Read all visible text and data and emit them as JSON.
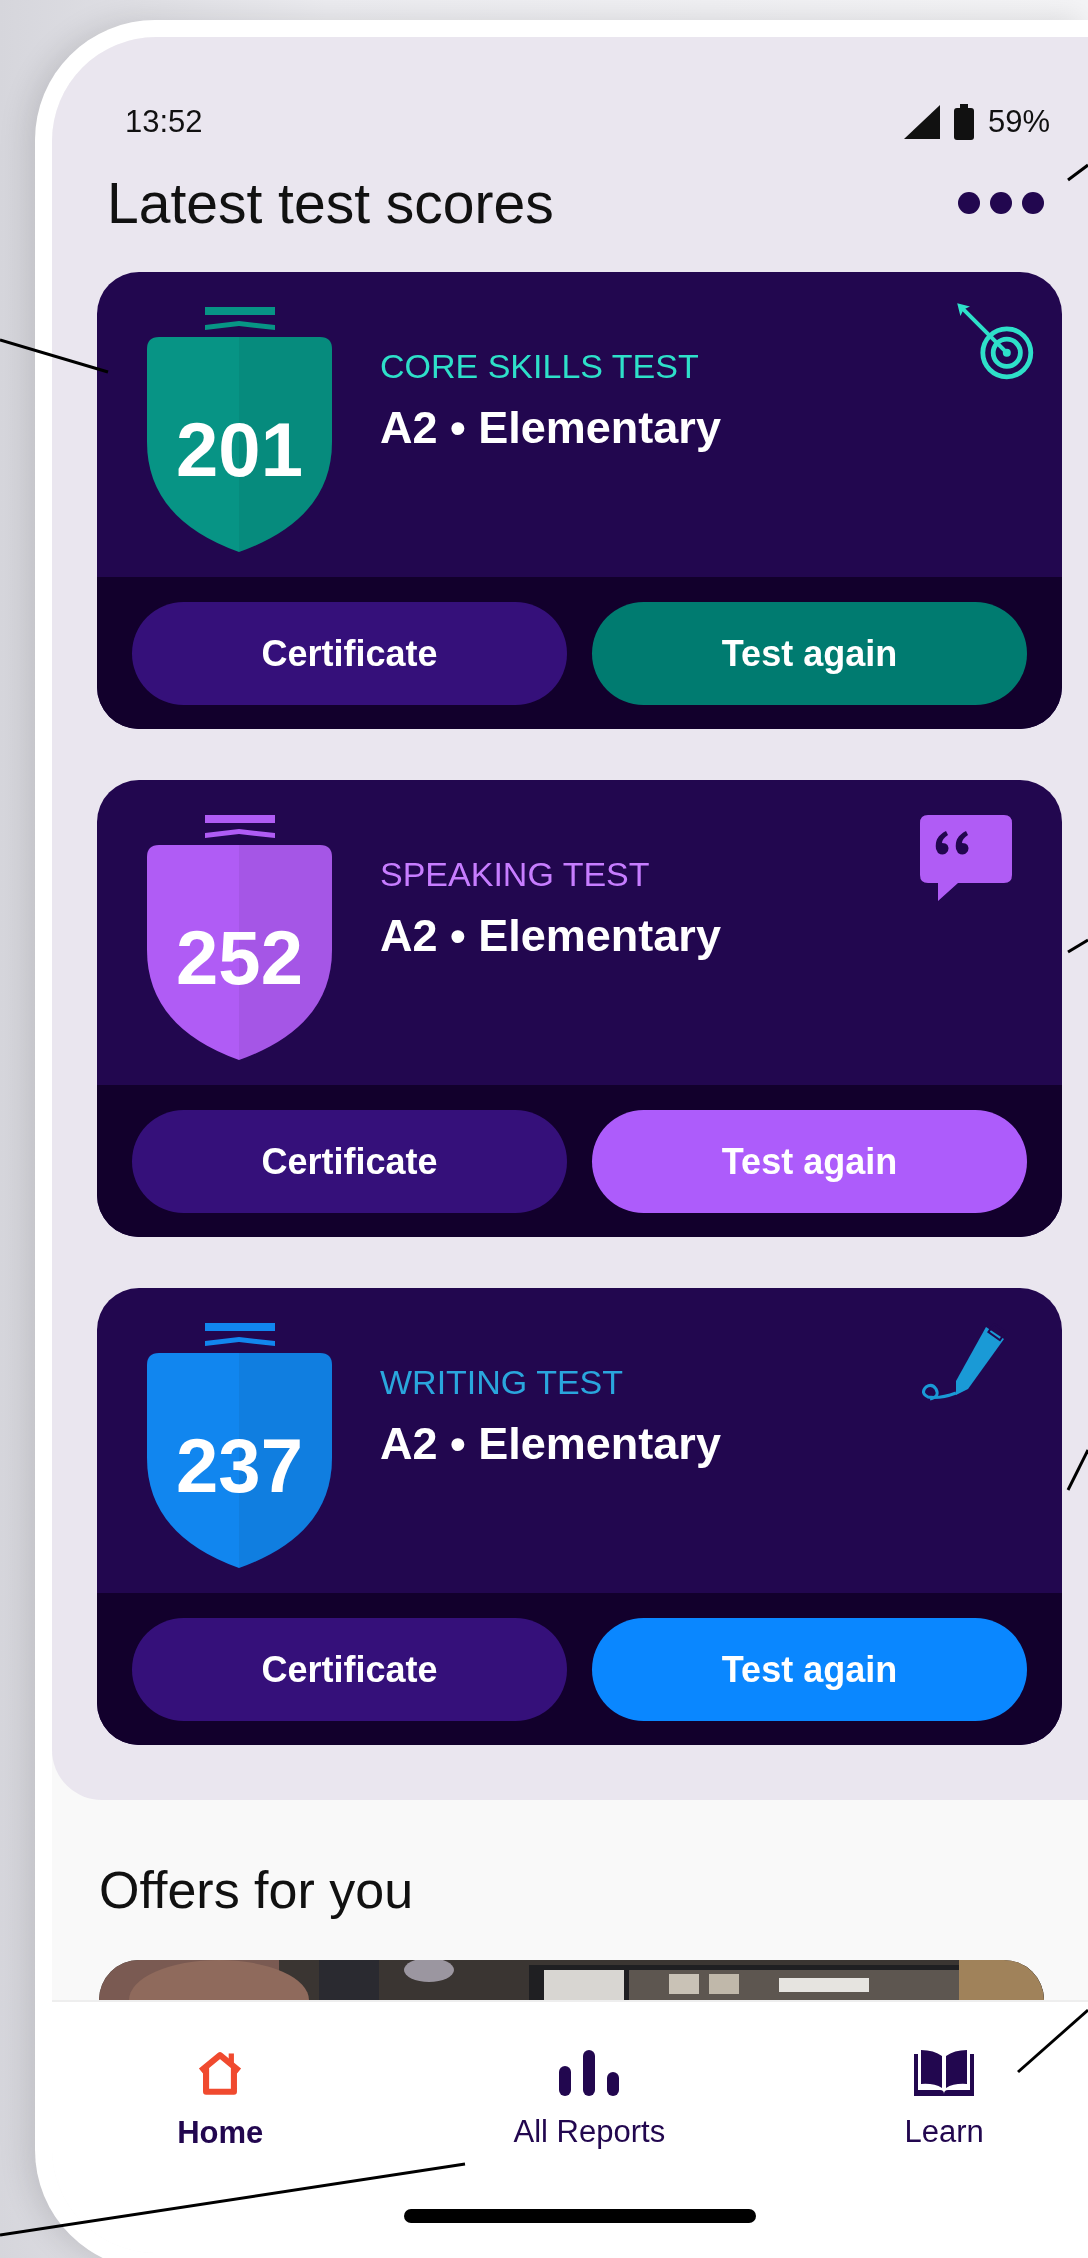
{
  "status_bar": {
    "time": "13:52",
    "battery": "59%"
  },
  "header": {
    "title": "Latest test scores"
  },
  "score_cards": [
    {
      "kind": "target",
      "label": "CORE SKILLS TEST",
      "score": "201",
      "level_text": "A2 • Elementary",
      "color": "#079485",
      "buttons": [
        "Certificate",
        "Test again"
      ]
    },
    {
      "kind": "quote",
      "label": "SPEAKING TEST",
      "score": "252",
      "level_text": "A2 • Elementary",
      "color": "#b05cf5",
      "buttons": [
        "Certificate",
        "Test again"
      ]
    },
    {
      "kind": "pencil",
      "label": "WRITING TEST",
      "score": "237",
      "level_text": "A2 • Elementary",
      "color": "#1186ef",
      "buttons": [
        "Certificate",
        "Test again"
      ]
    }
  ],
  "offers": {
    "title": "Offers for you"
  },
  "bottom_nav": [
    {
      "kind": "home",
      "label": "Home",
      "selected": true
    },
    {
      "kind": "reports",
      "label": "All Reports",
      "selected": false
    },
    {
      "kind": "learn",
      "label": "Learn",
      "selected": false
    }
  ]
}
